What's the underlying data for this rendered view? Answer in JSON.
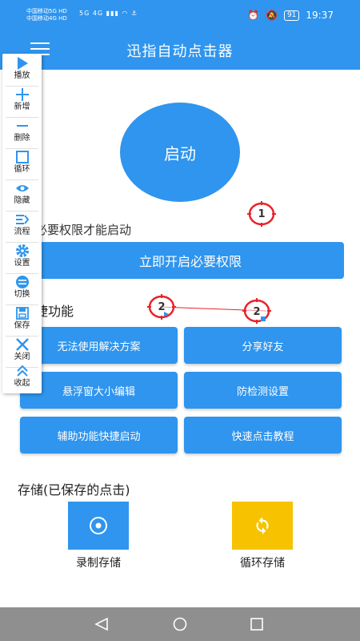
{
  "status_bar": {
    "carrier_1": "中国移动5G",
    "carrier_1_badge": "HD",
    "carrier_2": "中国移动4G",
    "carrier_2_badge": "HD",
    "network_icons": "5G 4G",
    "battery": "91",
    "time": "19:37"
  },
  "header": {
    "title": "迅指自动点击器"
  },
  "main": {
    "start_label": "启动",
    "permission_text": "必要权限才能启动",
    "permission_button": "立即开启必要权限",
    "shortcuts_title": "捷功能",
    "buttons": [
      "无法使用解决方案",
      "分享好友",
      "悬浮窗大小编辑",
      "防检测设置",
      "辅助功能快捷启动",
      "快速点击教程"
    ]
  },
  "storage": {
    "title": "存储(已保存的点击)",
    "record_label": "录制存储",
    "loop_label": "循环存储"
  },
  "toolbar": {
    "items": [
      {
        "label": "播放",
        "icon": "play-icon"
      },
      {
        "label": "新增",
        "icon": "plus-icon"
      },
      {
        "label": "删除",
        "icon": "minus-icon"
      },
      {
        "label": "循环",
        "icon": "square-icon"
      },
      {
        "label": "隐藏",
        "icon": "eye-icon"
      },
      {
        "label": "流程",
        "icon": "flow-icon"
      },
      {
        "label": "设置",
        "icon": "gear-icon"
      },
      {
        "label": "切换",
        "icon": "switch-icon"
      },
      {
        "label": "保存",
        "icon": "save-icon"
      },
      {
        "label": "关闭",
        "icon": "close-icon"
      },
      {
        "label": "收起",
        "icon": "collapse-icon"
      }
    ]
  },
  "markers": {
    "marker_1": "1",
    "marker_2a": "2",
    "marker_2b": "2"
  },
  "colors": {
    "primary": "#2f95ee",
    "loop_tile": "#f7c200",
    "marker_red": "#e8232b",
    "nav_bar": "#8f8f8f"
  }
}
